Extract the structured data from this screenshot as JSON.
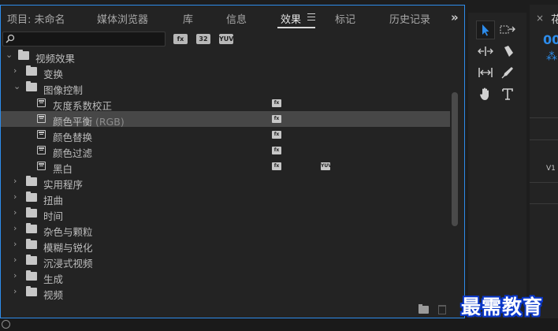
{
  "tabs": [
    {
      "label": "项目: 未命名",
      "active": false
    },
    {
      "label": "媒体浏览器",
      "active": false
    },
    {
      "label": "库",
      "active": false
    },
    {
      "label": "信息",
      "active": false
    },
    {
      "label": "效果",
      "active": true
    },
    {
      "label": "标记",
      "active": false
    },
    {
      "label": "历史记录",
      "active": false
    }
  ],
  "overflow_label": "»",
  "search": {
    "value": "",
    "placeholder": ""
  },
  "filter_buttons": [
    {
      "label": "fx",
      "name": "accelerated-effects"
    },
    {
      "label": "32",
      "name": "32bit-color"
    },
    {
      "label": "YUV",
      "name": "yuv-effects"
    }
  ],
  "tree": [
    {
      "label": "视频效果",
      "type": "folder",
      "expanded": true
    },
    {
      "label": "变换",
      "type": "folder",
      "expanded": false
    },
    {
      "label": "图像控制",
      "type": "folder",
      "expanded": true
    },
    {
      "label": "灰度系数校正",
      "type": "effect",
      "accelerated": true,
      "yuv": false
    },
    {
      "label": "颜色平衡",
      "suffix": "(RGB)",
      "type": "effect",
      "accelerated": true,
      "yuv": false,
      "selected": true
    },
    {
      "label": "颜色替换",
      "type": "effect",
      "accelerated": true,
      "yuv": false
    },
    {
      "label": "颜色过滤",
      "type": "effect",
      "accelerated": true,
      "yuv": false
    },
    {
      "label": "黑白",
      "type": "effect",
      "accelerated": true,
      "yuv": true
    },
    {
      "label": "实用程序",
      "type": "folder",
      "expanded": false
    },
    {
      "label": "扭曲",
      "type": "folder",
      "expanded": false
    },
    {
      "label": "时间",
      "type": "folder",
      "expanded": false
    },
    {
      "label": "杂色与颗粒",
      "type": "folder",
      "expanded": false
    },
    {
      "label": "模糊与锐化",
      "type": "folder",
      "expanded": false
    },
    {
      "label": "沉浸式视频",
      "type": "folder",
      "expanded": false
    },
    {
      "label": "生成",
      "type": "folder",
      "expanded": false
    },
    {
      "label": "视频",
      "type": "folder",
      "expanded": false
    }
  ],
  "tools": [
    "selection-tool",
    "track-select-tool",
    "ripple-edit-tool",
    "razor-tool",
    "slip-tool",
    "pen-tool",
    "hand-tool",
    "type-tool"
  ],
  "timeline": {
    "close": "×",
    "title": "花",
    "timecode": "00",
    "track_label": "V1"
  },
  "watermark": "最需教育",
  "colors": {
    "accent": "#2d8ceb",
    "panel_bg": "#232323",
    "selected_row": "#474747"
  }
}
